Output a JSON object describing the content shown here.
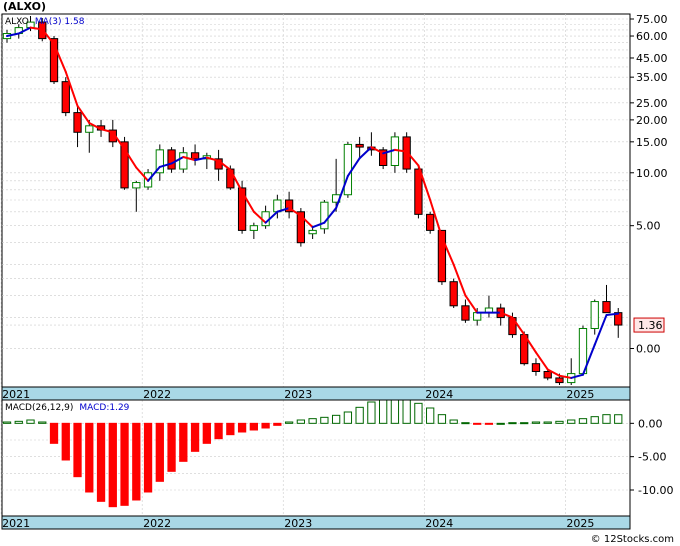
{
  "header": {
    "title": "(ALXO)"
  },
  "watermark": "© 12Stocks.com",
  "colors": {
    "up": "#008000",
    "down": "#ff0000",
    "ma_up": "#0000cc",
    "ma_down": "#ff0000",
    "grid": "#cccccc",
    "axis_band": "#a9d8e6",
    "macd_up": "#006600",
    "macd_down": "#ff0000"
  },
  "chart_data": [
    {
      "type": "candlestick",
      "name": "price",
      "legend": {
        "symbol": "ALXO",
        "ma_label": "MA(3)",
        "ma_value": "1.58"
      },
      "scale": "log",
      "y_tick_labels": [
        "75.00",
        "60.00",
        "45.00",
        "35.00",
        "25.00",
        "20.00",
        "15.00",
        "10.00",
        "5.00",
        "1.36",
        "0.00"
      ],
      "y_tick_values": [
        75,
        60,
        45,
        35,
        25,
        20,
        15,
        10,
        5,
        1.36,
        1.0
      ],
      "last_price_label": "1.36",
      "x_tick_labels": [
        "2021",
        "2022",
        "2023",
        "2024",
        "2025"
      ],
      "x_tick_index": [
        0,
        12,
        24,
        36,
        48
      ],
      "grid": true,
      "candles": [
        {
          "o": 58,
          "h": 65,
          "l": 55,
          "c": 62
        },
        {
          "o": 62,
          "h": 70,
          "l": 58,
          "c": 67
        },
        {
          "o": 67,
          "h": 78,
          "l": 64,
          "c": 72
        },
        {
          "o": 72,
          "h": 76,
          "l": 56,
          "c": 58
        },
        {
          "o": 58,
          "h": 60,
          "l": 32,
          "c": 33
        },
        {
          "o": 33,
          "h": 35,
          "l": 21,
          "c": 22
        },
        {
          "o": 22,
          "h": 24,
          "l": 14,
          "c": 17
        },
        {
          "o": 17,
          "h": 20,
          "l": 13,
          "c": 18.5
        },
        {
          "o": 18.5,
          "h": 20,
          "l": 16,
          "c": 17.5
        },
        {
          "o": 17.5,
          "h": 20,
          "l": 14,
          "c": 15
        },
        {
          "o": 15,
          "h": 16,
          "l": 8,
          "c": 8.2
        },
        {
          "o": 8.2,
          "h": 9,
          "l": 6,
          "c": 8.8
        },
        {
          "o": 8.3,
          "h": 10.5,
          "l": 8,
          "c": 10
        },
        {
          "o": 10,
          "h": 14.5,
          "l": 9,
          "c": 13.5
        },
        {
          "o": 13.5,
          "h": 14,
          "l": 10,
          "c": 10.5
        },
        {
          "o": 10.5,
          "h": 14,
          "l": 10,
          "c": 13
        },
        {
          "o": 13,
          "h": 14.5,
          "l": 11,
          "c": 12
        },
        {
          "o": 12,
          "h": 13,
          "l": 10.5,
          "c": 12.5
        },
        {
          "o": 12,
          "h": 13.5,
          "l": 9,
          "c": 10.5
        },
        {
          "o": 10.5,
          "h": 11,
          "l": 8,
          "c": 8.2
        },
        {
          "o": 8.2,
          "h": 9,
          "l": 4.5,
          "c": 4.7
        },
        {
          "o": 4.7,
          "h": 5.2,
          "l": 4.2,
          "c": 5
        },
        {
          "o": 5,
          "h": 6.5,
          "l": 4.8,
          "c": 6
        },
        {
          "o": 6,
          "h": 7.5,
          "l": 5.5,
          "c": 7
        },
        {
          "o": 7,
          "h": 7.8,
          "l": 5.5,
          "c": 6
        },
        {
          "o": 6,
          "h": 6.3,
          "l": 3.8,
          "c": 4
        },
        {
          "o": 4.5,
          "h": 5,
          "l": 4.2,
          "c": 4.7
        },
        {
          "o": 4.8,
          "h": 7,
          "l": 4.5,
          "c": 6.8
        },
        {
          "o": 6.8,
          "h": 12,
          "l": 6,
          "c": 7.5
        },
        {
          "o": 7.5,
          "h": 15,
          "l": 7.2,
          "c": 14.5
        },
        {
          "o": 14.5,
          "h": 16,
          "l": 12,
          "c": 14
        },
        {
          "o": 14,
          "h": 17,
          "l": 12.5,
          "c": 13.5
        },
        {
          "o": 13.5,
          "h": 14,
          "l": 10.5,
          "c": 11
        },
        {
          "o": 11,
          "h": 17,
          "l": 10,
          "c": 16
        },
        {
          "o": 16,
          "h": 17,
          "l": 10,
          "c": 10.5
        },
        {
          "o": 10.5,
          "h": 11,
          "l": 5.5,
          "c": 5.8
        },
        {
          "o": 5.8,
          "h": 6,
          "l": 4.5,
          "c": 4.7
        },
        {
          "o": 4.7,
          "h": 3.8,
          "l": 2.3,
          "c": 2.4
        },
        {
          "o": 2.4,
          "h": 2.5,
          "l": 1.7,
          "c": 1.75
        },
        {
          "o": 1.75,
          "h": 1.9,
          "l": 1.4,
          "c": 1.45
        },
        {
          "o": 1.45,
          "h": 1.7,
          "l": 1.35,
          "c": 1.6
        },
        {
          "o": 1.6,
          "h": 2,
          "l": 1.5,
          "c": 1.7
        },
        {
          "o": 1.7,
          "h": 1.8,
          "l": 1.35,
          "c": 1.5
        },
        {
          "o": 1.5,
          "h": 1.6,
          "l": 1.15,
          "c": 1.2
        },
        {
          "o": 1.2,
          "h": 1.25,
          "l": 0.8,
          "c": 0.82
        },
        {
          "o": 0.82,
          "h": 0.88,
          "l": 0.7,
          "c": 0.74
        },
        {
          "o": 0.74,
          "h": 0.76,
          "l": 0.66,
          "c": 0.68
        },
        {
          "o": 0.68,
          "h": 0.72,
          "l": 0.62,
          "c": 0.64
        },
        {
          "o": 0.64,
          "h": 0.88,
          "l": 0.62,
          "c": 0.72
        },
        {
          "o": 0.72,
          "h": 1.35,
          "l": 0.7,
          "c": 1.3
        },
        {
          "o": 1.3,
          "h": 1.9,
          "l": 1.2,
          "c": 1.85
        },
        {
          "o": 1.85,
          "h": 2.3,
          "l": 1.75,
          "c": 1.6
        },
        {
          "o": 1.6,
          "h": 1.7,
          "l": 1.15,
          "c": 1.36
        }
      ],
      "ma": [
        60,
        62,
        67,
        65.5,
        54,
        37.5,
        24,
        19.2,
        17.7,
        17,
        13.6,
        10.7,
        9,
        10.8,
        11.3,
        12.3,
        11.8,
        12.2,
        11.7,
        10.4,
        7.8,
        6,
        5.2,
        6,
        6.3,
        5.7,
        4.9,
        5.2,
        6.3,
        9.6,
        12.1,
        14,
        12.9,
        13.5,
        13.2,
        11,
        7,
        4.3,
        3,
        2,
        1.6,
        1.6,
        1.6,
        1.5,
        1.2,
        0.95,
        0.76,
        0.7,
        0.68,
        0.71,
        1.05,
        1.55,
        1.58
      ]
    },
    {
      "type": "bar",
      "name": "macd",
      "legend": {
        "label": "MACD(26,12,9)",
        "value_label": "MACD:1.29"
      },
      "y_tick_labels": [
        "0.00",
        "-5.00",
        "-10.00"
      ],
      "y_tick_values": [
        0,
        -5,
        -10
      ],
      "ylim": [
        -13.9,
        3.5
      ],
      "x_tick_labels": [
        "2021",
        "2022",
        "2023",
        "2024",
        "2025"
      ],
      "x_tick_index": [
        0,
        12,
        24,
        36,
        48
      ],
      "values": [
        0.2,
        0.3,
        0.5,
        0.2,
        -3,
        -5.5,
        -8,
        -10.3,
        -11.7,
        -12.5,
        -12.3,
        -11.5,
        -10.3,
        -8.7,
        -7.2,
        -5.7,
        -4.2,
        -3,
        -2.3,
        -1.7,
        -1.3,
        -1,
        -0.7,
        -0.3,
        0.2,
        0.5,
        0.7,
        0.9,
        1.2,
        1.7,
        2.4,
        3.2,
        3.6,
        3.7,
        3.6,
        3,
        2.3,
        1.3,
        0.5,
        0.1,
        -0.1,
        -0.1,
        0,
        0.1,
        0.1,
        0.2,
        0.2,
        0.3,
        0.5,
        0.7,
        1,
        1.3,
        1.29
      ]
    }
  ]
}
